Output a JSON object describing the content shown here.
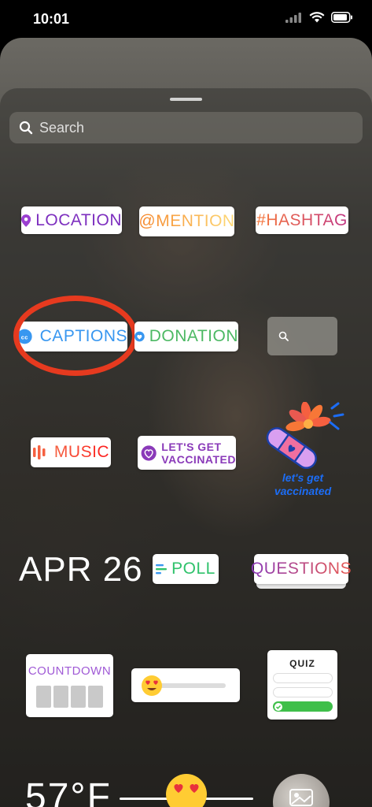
{
  "status": {
    "time": "10:01"
  },
  "search": {
    "placeholder": "Search"
  },
  "stickers": {
    "location": "LOCATION",
    "mention": "@MENTION",
    "hashtag": "#HASHTAG",
    "captions": "CAPTIONS",
    "donation": "DONATION",
    "music": "MUSIC",
    "vaccinated_badge": [
      "LET'S GET",
      "VACCINATED"
    ],
    "vaccinated_art": [
      "let's get",
      "vaccinated"
    ],
    "date": "APR 26",
    "poll": "POLL",
    "questions": "QUESTIONS",
    "countdown": "COUNTDOWN",
    "quiz": "QUIZ",
    "temperature": "57°F"
  },
  "colors": {
    "captions_blue": "#3897f0",
    "donation_green": "#4cb963",
    "poll_green": "#2fc26b",
    "countdown_purple": "#a05ad6",
    "highlight_ring": "#e63a1f"
  }
}
